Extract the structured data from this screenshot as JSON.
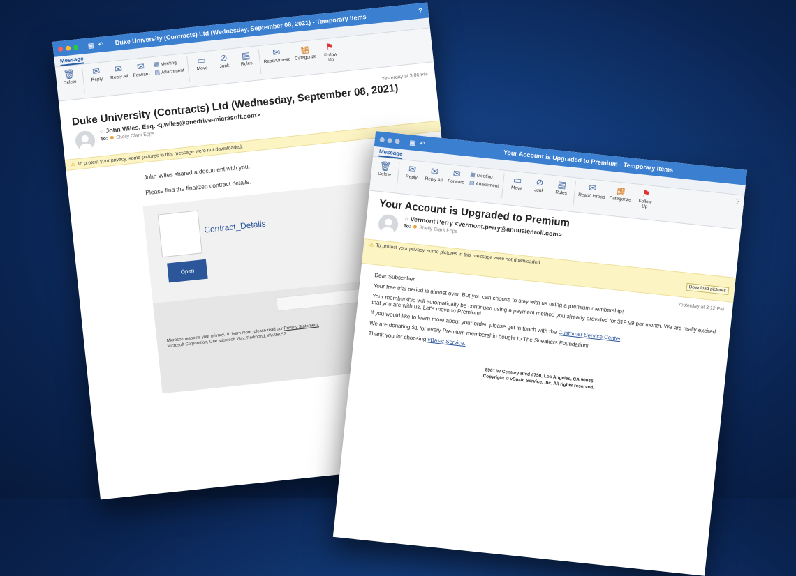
{
  "ribbon": {
    "tab": "Message",
    "delete": "Delete",
    "reply": "Reply",
    "reply_all": "Reply All",
    "forward": "Forward",
    "meeting": "Meeting",
    "attachment": "Attachment",
    "move": "Move",
    "junk": "Junk",
    "rules": "Rules",
    "read_unread": "Read/Unread",
    "categorize": "Categorize",
    "follow_up": "Follow Up"
  },
  "email1": {
    "window_title": "Duke University (Contracts) Ltd (Wednesday, September 08, 2021) - Temporary Items",
    "subject": "Duke University (Contracts) Ltd (Wednesday, September 08, 2021)",
    "timestamp": "Yesterday at 3:06 PM",
    "sender": "John Wiles, Esq. <j.wiles@onedrive-micrasoft.com>",
    "to_label": "To:",
    "recipient": "Shelly Clark Epps",
    "privacy_notice": "To protect your privacy, some pictures in this message were not downloaded.",
    "body": [
      "John Wiles shared a document with you.",
      "Please find the finalized contract details."
    ],
    "doc_link": "Contract_Details",
    "open_button": "Open",
    "footer_line1": "Microsoft respects your privacy. To learn more, please read our",
    "footer_link": "Privacy Statement.",
    "footer_line2": "Microsoft Corporation, One Microsoft Way, Redmond, WA 98052"
  },
  "email2": {
    "window_title": "Your Account is Upgraded to Premium - Temporary Items",
    "subject": "Your Account is Upgraded to Premium",
    "timestamp": "Yesterday at 3:12 PM",
    "sender": "Vermont Perry <vermont.perry@annualenroll.com>",
    "to_label": "To:",
    "recipient": "Shelly Clark Epps",
    "privacy_notice": "To protect your privacy, some pictures in this message were not downloaded.",
    "download_button": "Download pictures",
    "greeting": "Dear Subscriber,",
    "p1": "Your free trial period is almost over.  But you can choose to stay with us using a premium membership!",
    "p2": "Your membership will automatically be continued using a payment method you already provided for $19.99 per month. We are really excited that you are with us. Let's move to Premium!",
    "p3_pre": "If you would like to learn more about your order, please get in touch with the",
    "p3_link": "Customer Service Center",
    "p4": "We are donating $1 for every Premium membership bought to The Sneakers Foundation!",
    "p5_pre": "Thank you for choosing",
    "p5_link": "vBasic Service.",
    "address1": "5901 W Century Blvd #750, Los Angeles, CA 90045",
    "address2": "Copyright © vBasic Service, Inc. All rights reserved."
  },
  "icons": {
    "help": "?",
    "save": "▣",
    "undo": "↶",
    "warning": "⚠",
    "delete": "🗑",
    "reply": "✉",
    "meeting": "▦",
    "attachment": "▤",
    "move": "▭",
    "junk": "⊘",
    "rules": "▤",
    "read": "✉",
    "categorize": "▦",
    "flag": "⚑"
  },
  "colors": {
    "titlebar": "#3b7fd0",
    "link": "#2b579a",
    "privacy_bar": "#fdf4c3"
  }
}
